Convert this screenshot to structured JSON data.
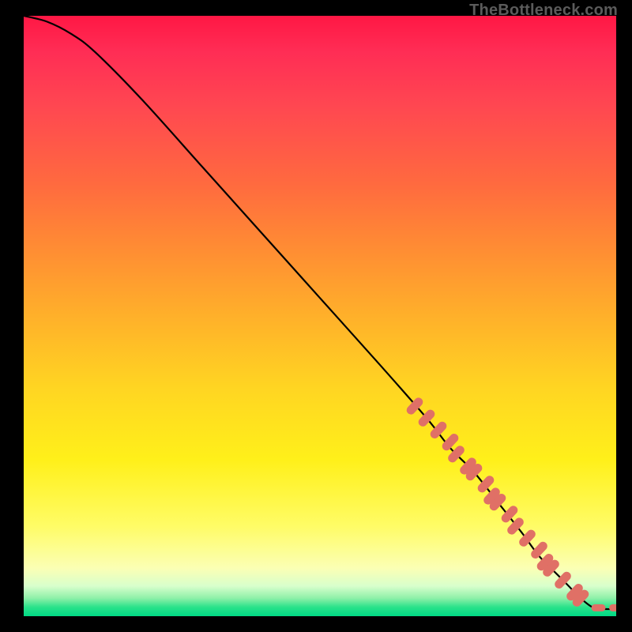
{
  "attribution": "TheBottleneck.com",
  "colors": {
    "background": "#000000",
    "curve": "#000000",
    "marker": "#e07066",
    "gradient_top": "#ff1744",
    "gradient_mid": "#ffe01a",
    "gradient_bottom": "#00d985"
  },
  "chart_data": {
    "type": "line",
    "title": "",
    "xlabel": "",
    "ylabel": "",
    "xlim": [
      0,
      100
    ],
    "ylim": [
      0,
      100
    ],
    "grid": false,
    "note": "Axes are not labeled in the source image; values below are normalized 0–100 estimates read off pixel positions. y runs bottom-to-top (100 = top = red, 0 = bottom = green).",
    "series": [
      {
        "name": "curve",
        "x": [
          0,
          4,
          8,
          12,
          20,
          30,
          40,
          50,
          60,
          68,
          72,
          76,
          80,
          84,
          87,
          90,
          92,
          94,
          96,
          98,
          100
        ],
        "y": [
          100,
          99,
          97,
          94,
          86,
          75,
          64,
          53,
          42,
          33,
          28,
          24,
          19,
          14,
          10,
          7,
          5,
          3,
          1.5,
          1.2,
          1.2
        ]
      }
    ],
    "markers": {
      "name": "highlighted-points",
      "note": "Salmon dot clusters along the lower-right segment of the curve (approximate centers).",
      "x": [
        66,
        68,
        70,
        72,
        73,
        75,
        76,
        78,
        79,
        80,
        82,
        83,
        85,
        87,
        88,
        89,
        91,
        93,
        94,
        97,
        100
      ],
      "y": [
        35,
        33,
        31,
        29,
        27,
        25,
        24,
        22,
        20,
        19,
        17,
        15,
        13,
        11,
        9,
        8,
        6,
        4,
        3,
        1.4,
        1.4
      ]
    }
  }
}
